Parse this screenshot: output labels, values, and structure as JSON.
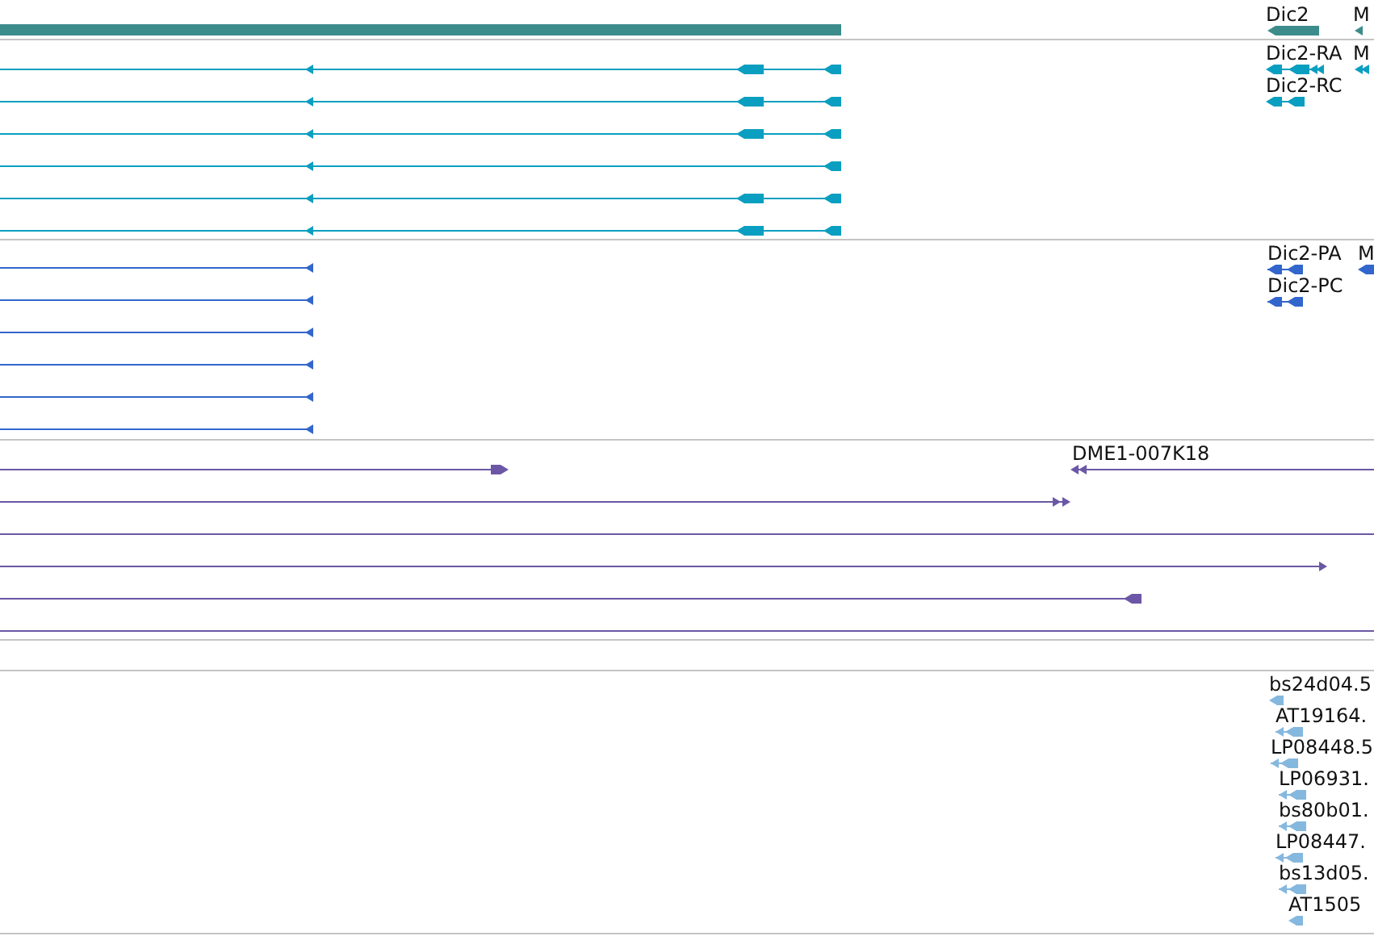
{
  "tracks": [
    {
      "kind": "gene",
      "color": "#3d8c8c",
      "labels": [
        "Dic2",
        "M"
      ]
    },
    {
      "kind": "transcript",
      "color": "#0a9fc0",
      "labels": [
        "Dic2-RA",
        "Dic2-RC",
        "M"
      ]
    },
    {
      "kind": "protein",
      "color": "#3366cc",
      "labels": [
        "Dic2-PA",
        "Dic2-PC",
        "M"
      ]
    },
    {
      "kind": "clone",
      "color": "#6b57a5",
      "labels": [
        "DME1-007K18"
      ]
    },
    {
      "kind": "cdna",
      "color": "#85b8de",
      "labels": [
        "bs24d04.5",
        "AT19164.",
        "LP08448.5",
        "LP06931.",
        "bs80b01.",
        "LP08447.",
        "bs13d05.",
        "AT1505"
      ]
    }
  ]
}
